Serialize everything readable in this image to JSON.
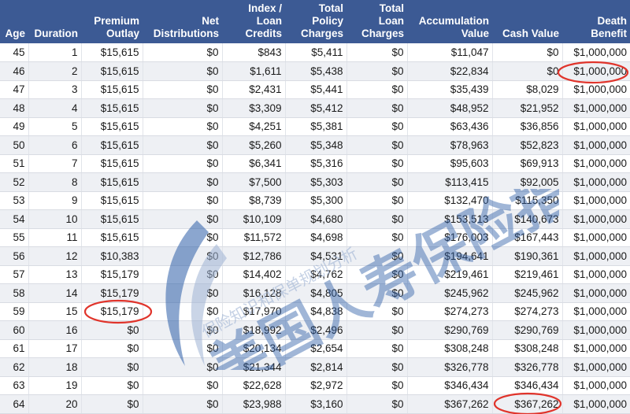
{
  "headers": [
    "Age",
    "Duration",
    "Premium\nOutlay",
    "Net\nDistributions",
    "Index /\nLoan\nCredits",
    "Total\nPolicy\nCharges",
    "Total\nLoan\nCharges",
    "Accumulation\nValue",
    "Cash Value",
    "Death\nBenefit"
  ],
  "rows": [
    [
      "45",
      "1",
      "$15,615",
      "$0",
      "$843",
      "$5,411",
      "$0",
      "$11,047",
      "$0",
      "$1,000,000"
    ],
    [
      "46",
      "2",
      "$15,615",
      "$0",
      "$1,611",
      "$5,438",
      "$0",
      "$22,834",
      "$0",
      "$1,000,000"
    ],
    [
      "47",
      "3",
      "$15,615",
      "$0",
      "$2,431",
      "$5,441",
      "$0",
      "$35,439",
      "$8,029",
      "$1,000,000"
    ],
    [
      "48",
      "4",
      "$15,615",
      "$0",
      "$3,309",
      "$5,412",
      "$0",
      "$48,952",
      "$21,952",
      "$1,000,000"
    ],
    [
      "49",
      "5",
      "$15,615",
      "$0",
      "$4,251",
      "$5,381",
      "$0",
      "$63,436",
      "$36,856",
      "$1,000,000"
    ],
    [
      "50",
      "6",
      "$15,615",
      "$0",
      "$5,260",
      "$5,348",
      "$0",
      "$78,963",
      "$52,823",
      "$1,000,000"
    ],
    [
      "51",
      "7",
      "$15,615",
      "$0",
      "$6,341",
      "$5,316",
      "$0",
      "$95,603",
      "$69,913",
      "$1,000,000"
    ],
    [
      "52",
      "8",
      "$15,615",
      "$0",
      "$7,500",
      "$5,303",
      "$0",
      "$113,415",
      "$92,005",
      "$1,000,000"
    ],
    [
      "53",
      "9",
      "$15,615",
      "$0",
      "$8,739",
      "$5,300",
      "$0",
      "$132,470",
      "$115,350",
      "$1,000,000"
    ],
    [
      "54",
      "10",
      "$15,615",
      "$0",
      "$10,109",
      "$4,680",
      "$0",
      "$153,513",
      "$140,673",
      "$1,000,000"
    ],
    [
      "55",
      "11",
      "$15,615",
      "$0",
      "$11,572",
      "$4,698",
      "$0",
      "$176,003",
      "$167,443",
      "$1,000,000"
    ],
    [
      "56",
      "12",
      "$10,383",
      "$0",
      "$12,786",
      "$4,531",
      "$0",
      "$194,641",
      "$190,361",
      "$1,000,000"
    ],
    [
      "57",
      "13",
      "$15,179",
      "$0",
      "$14,402",
      "$4,762",
      "$0",
      "$219,461",
      "$219,461",
      "$1,000,000"
    ],
    [
      "58",
      "14",
      "$15,179",
      "$0",
      "$16,128",
      "$4,805",
      "$0",
      "$245,962",
      "$245,962",
      "$1,000,000"
    ],
    [
      "59",
      "15",
      "$15,179",
      "$0",
      "$17,970",
      "$4,838",
      "$0",
      "$274,273",
      "$274,273",
      "$1,000,000"
    ],
    [
      "60",
      "16",
      "$0",
      "$0",
      "$18,992",
      "$2,496",
      "$0",
      "$290,769",
      "$290,769",
      "$1,000,000"
    ],
    [
      "61",
      "17",
      "$0",
      "$0",
      "$20,134",
      "$2,654",
      "$0",
      "$308,248",
      "$308,248",
      "$1,000,000"
    ],
    [
      "62",
      "18",
      "$0",
      "$0",
      "$21,344",
      "$2,814",
      "$0",
      "$326,778",
      "$326,778",
      "$1,000,000"
    ],
    [
      "63",
      "19",
      "$0",
      "$0",
      "$22,628",
      "$2,972",
      "$0",
      "$346,434",
      "$346,434",
      "$1,000,000"
    ],
    [
      "64",
      "20",
      "$0",
      "$0",
      "$23,988",
      "$3,160",
      "$0",
      "$367,262",
      "$367,262",
      "$1,000,000"
    ]
  ],
  "watermark": {
    "main_text": "美国人寿保险指南",
    "sub_text": "保险知识和保单规划分析",
    "colors": [
      "#2e5fa8",
      "#9fb4d4"
    ]
  },
  "highlight_color": "#e0342b",
  "header_color": "#3c5a94"
}
